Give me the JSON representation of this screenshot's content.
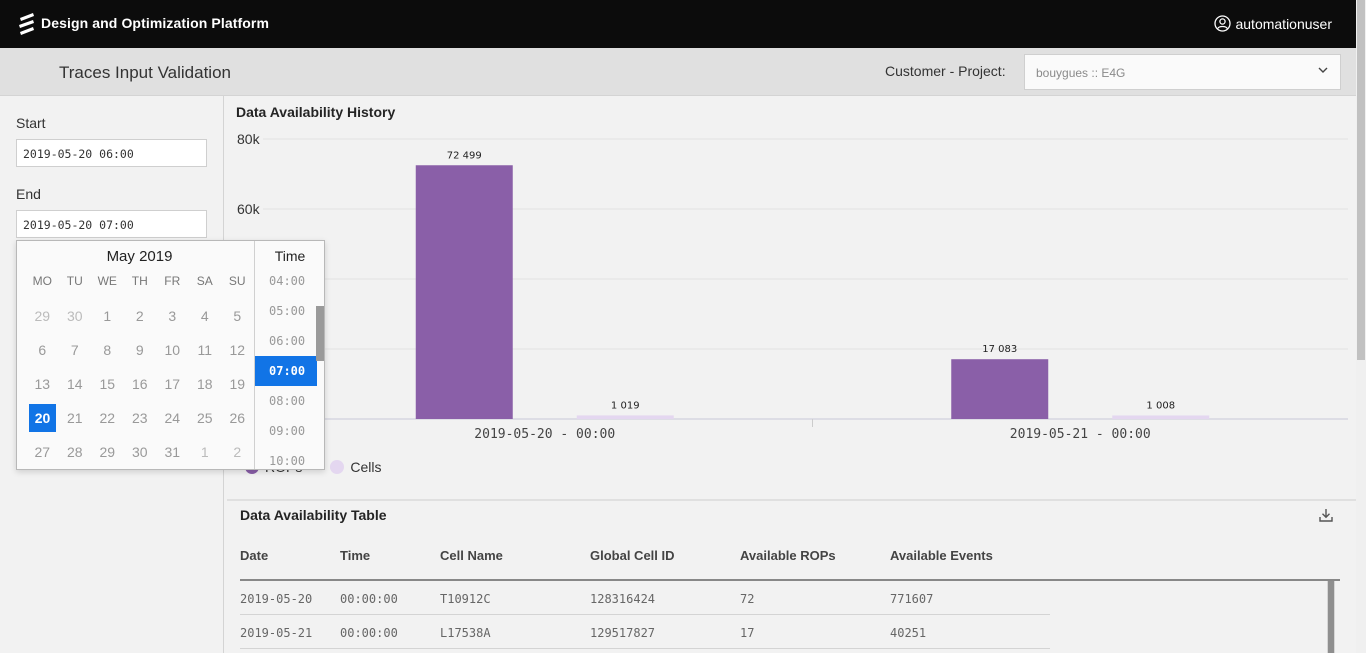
{
  "app": {
    "title": "Design and Optimization Platform",
    "user": "automationuser"
  },
  "header": {
    "page_title": "Traces Input Validation",
    "customer_project_label": "Customer - Project:",
    "customer_project_value": "bouygues :: E4G"
  },
  "filters": {
    "start_label": "Start",
    "start_value": "2019-05-20 06:00",
    "end_label": "End",
    "end_value": "2019-05-20 07:00"
  },
  "datepicker": {
    "month": "May 2019",
    "weekdays": [
      "MO",
      "TU",
      "WE",
      "TH",
      "FR",
      "SA",
      "SU"
    ],
    "days": [
      {
        "d": "29",
        "cur": false
      },
      {
        "d": "30",
        "cur": false
      },
      {
        "d": "1",
        "cur": true
      },
      {
        "d": "2",
        "cur": true
      },
      {
        "d": "3",
        "cur": true
      },
      {
        "d": "4",
        "cur": true
      },
      {
        "d": "5",
        "cur": true
      },
      {
        "d": "6",
        "cur": true
      },
      {
        "d": "7",
        "cur": true
      },
      {
        "d": "8",
        "cur": true
      },
      {
        "d": "9",
        "cur": true
      },
      {
        "d": "10",
        "cur": true
      },
      {
        "d": "11",
        "cur": true
      },
      {
        "d": "12",
        "cur": true
      },
      {
        "d": "13",
        "cur": true
      },
      {
        "d": "14",
        "cur": true
      },
      {
        "d": "15",
        "cur": true
      },
      {
        "d": "16",
        "cur": true
      },
      {
        "d": "17",
        "cur": true
      },
      {
        "d": "18",
        "cur": true
      },
      {
        "d": "19",
        "cur": true
      },
      {
        "d": "20",
        "cur": true,
        "active": true
      },
      {
        "d": "21",
        "cur": true
      },
      {
        "d": "22",
        "cur": true
      },
      {
        "d": "23",
        "cur": true
      },
      {
        "d": "24",
        "cur": true
      },
      {
        "d": "25",
        "cur": true
      },
      {
        "d": "26",
        "cur": true
      },
      {
        "d": "27",
        "cur": true
      },
      {
        "d": "28",
        "cur": true
      },
      {
        "d": "29",
        "cur": true
      },
      {
        "d": "30",
        "cur": true
      },
      {
        "d": "31",
        "cur": true
      },
      {
        "d": "1",
        "cur": false
      },
      {
        "d": "2",
        "cur": false
      }
    ],
    "time_label": "Time",
    "times": [
      "04:00",
      "05:00",
      "06:00",
      "07:00",
      "08:00",
      "09:00",
      "10:00"
    ],
    "selected_time": "07:00"
  },
  "chart_card": {
    "title": "Data Availability History"
  },
  "chart_data": {
    "type": "bar",
    "categories": [
      "2019-05-20 - 00:00",
      "2019-05-21 - 00:00"
    ],
    "series": [
      {
        "name": "ROPs",
        "values": [
          72499,
          17083
        ],
        "labels": [
          "72 499",
          "17 083"
        ]
      },
      {
        "name": "Cells",
        "values": [
          1019,
          1008
        ],
        "labels": [
          "1 019",
          "1 008"
        ]
      }
    ],
    "ylim": [
      0,
      80000
    ],
    "yticks": [
      {
        "v": 60000,
        "label": "60k"
      },
      {
        "v": 80000,
        "label": "80k"
      }
    ],
    "grid": true,
    "legend_position": "bottom-left",
    "colors": {
      "ROPs": "#8a5fa8",
      "Cells": "#e4d7f0"
    }
  },
  "table_card": {
    "title": "Data Availability Table",
    "download_icon": "download-icon",
    "columns": [
      "Date",
      "Time",
      "Cell Name",
      "Global Cell ID",
      "Available ROPs",
      "Available Events"
    ],
    "rows": [
      [
        "2019-05-20",
        "00:00:00",
        "T10912C",
        "128316424",
        "72",
        "771607"
      ],
      [
        "2019-05-21",
        "00:00:00",
        "L17538A",
        "129517827",
        "17",
        "40251"
      ]
    ]
  },
  "colors": {
    "accent": "#1174e6",
    "topbar": "#0c0c0c"
  }
}
